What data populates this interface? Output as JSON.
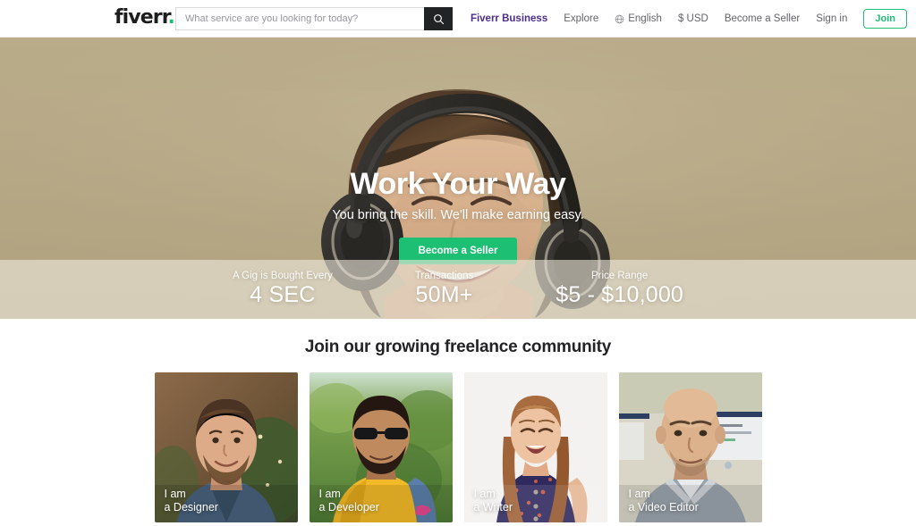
{
  "header": {
    "logo_text": "fiverr",
    "logo_dot": ".",
    "search": {
      "placeholder": "What service are you looking for today?",
      "value": "",
      "button_icon": "search-icon"
    },
    "nav": [
      {
        "label": "Fiverr Business",
        "style": "business"
      },
      {
        "label": "Explore",
        "style": "plain"
      },
      {
        "label": "English",
        "style": "lang",
        "icon": "globe-icon"
      },
      {
        "label": "$ USD",
        "style": "plain"
      },
      {
        "label": "Become a Seller",
        "style": "plain"
      },
      {
        "label": "Sign in",
        "style": "plain"
      }
    ],
    "join_label": "Join"
  },
  "hero": {
    "title": "Work Your Way",
    "subtitle": "You bring the skill. We'll make earning easy.",
    "cta_label": "Become a Seller",
    "background_description": "Smiling woman with dark bob hair wearing large black over-ear headphones, warm khaki studio backdrop",
    "bg_color": "#b3a583"
  },
  "stats": [
    {
      "label": "A Gig is Bought Every",
      "value": "4 SEC"
    },
    {
      "label": "Transactions",
      "value": "50M+"
    },
    {
      "label": "Price Range",
      "value": "$5 - $10,000"
    }
  ],
  "community": {
    "heading": "Join our growing freelance community",
    "cards": [
      {
        "line1": "I am",
        "line2": "a Designer",
        "role": "Designer"
      },
      {
        "line1": "I am",
        "line2": "a Developer",
        "role": "Developer"
      },
      {
        "line1": "I am",
        "line2": "a Writer",
        "role": "Writer"
      },
      {
        "line1": "I am",
        "line2": "a Video Editor",
        "role": "Video Editor"
      }
    ]
  },
  "colors": {
    "brand_green": "#1dbf73",
    "business_purple": "#4d2e8e",
    "search_button": "#222325",
    "hero_bg": "#b3a583",
    "stats_bar": "#ede8dc",
    "text_dark": "#222325",
    "text_muted": "#62646a"
  }
}
